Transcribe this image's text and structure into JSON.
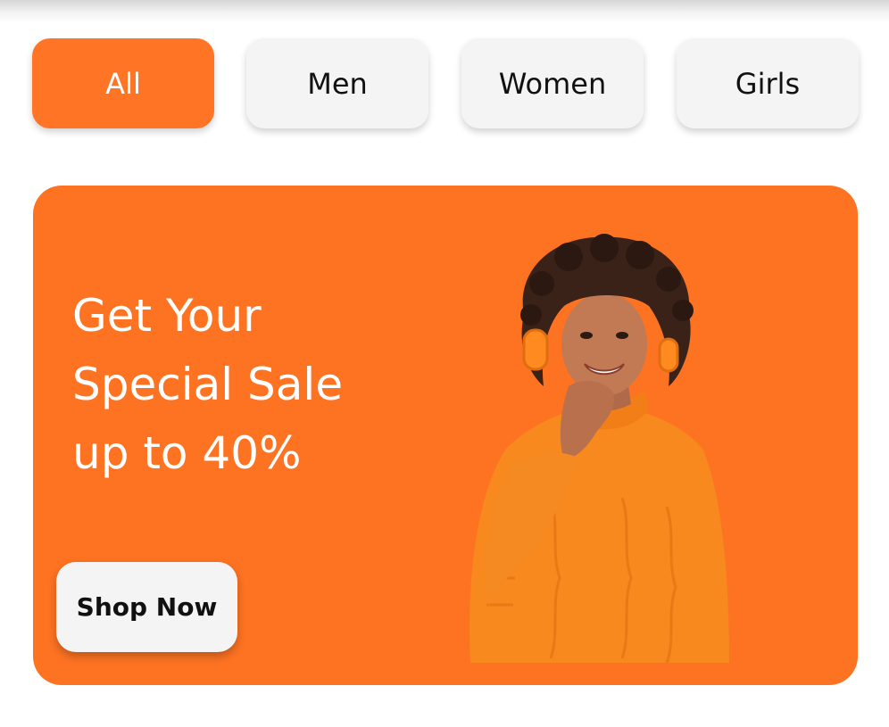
{
  "filters": {
    "items": [
      {
        "label": "All",
        "active": true
      },
      {
        "label": "Men",
        "active": false
      },
      {
        "label": "Women",
        "active": false
      },
      {
        "label": "Girls",
        "active": false
      }
    ]
  },
  "banner": {
    "headline_lines": [
      "Get Your",
      "Special Sale",
      "up to 40%"
    ],
    "cta_label": "Shop Now",
    "image_icon": "woman-with-headphones-illustration"
  },
  "colors": {
    "accent": "#fe7322",
    "chip_background": "#f4f4f4",
    "text_dark": "#111111",
    "text_light": "#ffffff"
  }
}
